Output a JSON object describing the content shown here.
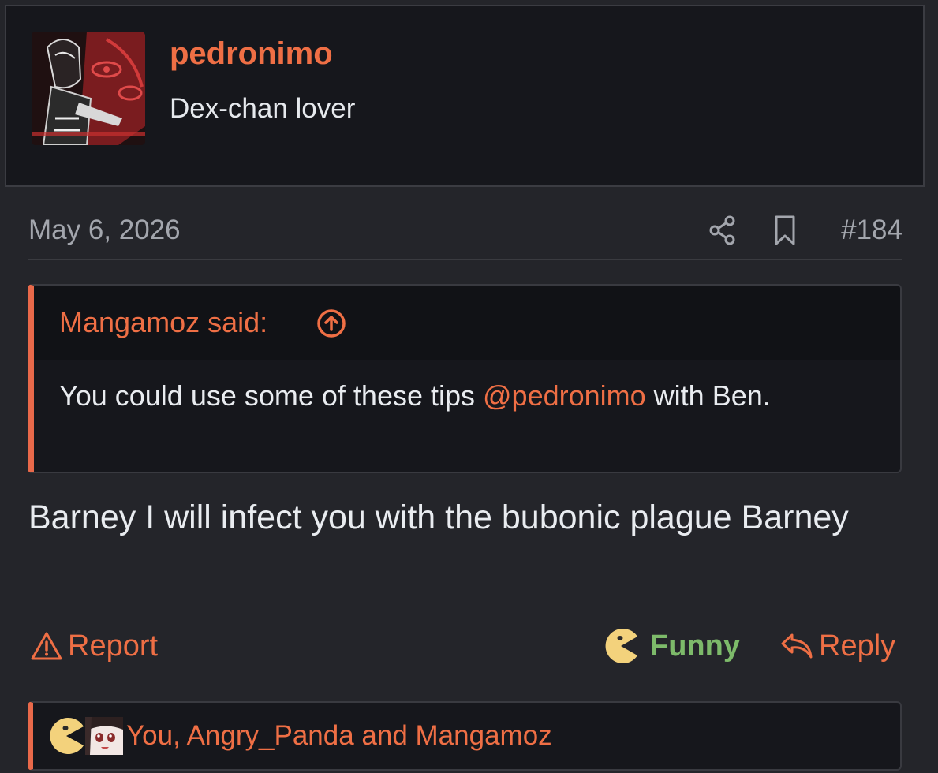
{
  "post": {
    "author": {
      "username": "pedronimo",
      "title": "Dex-chan lover"
    },
    "date": "May 6, 2026",
    "number": "#184",
    "quote": {
      "author_label": "Mangamoz said:",
      "text_before": "You could use some of these tips ",
      "mention": "@pedronimo",
      "text_after": " with Ben."
    },
    "body": "Barney I will infect you with the bubonic plague Barney",
    "actions": {
      "report": "Report",
      "funny": "Funny",
      "reply": "Reply"
    },
    "reactions": {
      "summary": "You, Angry_Panda and Mangamoz"
    }
  },
  "colors": {
    "accent": "#ef6f45",
    "funny_green": "#7dba6a",
    "background": "#24252a",
    "card": "#16171c"
  },
  "icons": [
    "share-icon",
    "bookmark-icon",
    "arrow-up-circle-icon",
    "warning-icon",
    "pacman-emoji-icon",
    "reply-icon"
  ]
}
